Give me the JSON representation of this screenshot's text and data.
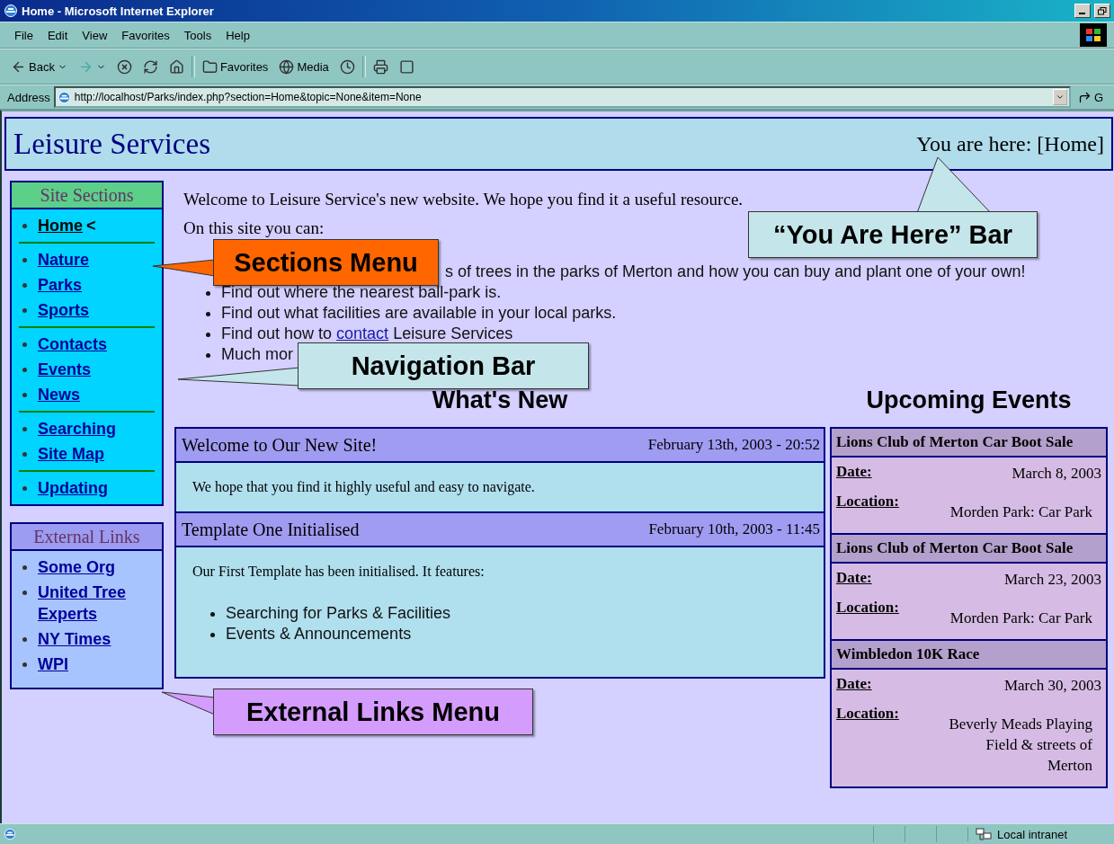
{
  "window": {
    "title": "Home - Microsoft Internet Explorer"
  },
  "menu": [
    "File",
    "Edit",
    "View",
    "Favorites",
    "Tools",
    "Help"
  ],
  "toolbar": [
    {
      "kind": "back",
      "label": "Back"
    },
    {
      "kind": "forward"
    },
    {
      "kind": "stop"
    },
    {
      "kind": "refresh"
    },
    {
      "kind": "home"
    },
    {
      "kind": "separator"
    },
    {
      "kind": "favorites",
      "label": "Favorites"
    },
    {
      "kind": "media",
      "label": "Media"
    },
    {
      "kind": "history"
    },
    {
      "kind": "separator"
    },
    {
      "kind": "print"
    },
    {
      "kind": "edit"
    }
  ],
  "address": {
    "label": "Address",
    "value": "http://localhost/Parks/index.php?section=Home&topic=None&item=None",
    "go": "G"
  },
  "header": {
    "title": "Leisure Services",
    "breadcrumb": "You are here: [Home]"
  },
  "site_sections": {
    "title": "Site Sections",
    "groups": [
      [
        {
          "label": "Home",
          "selected": true,
          "marker": "<"
        }
      ],
      [
        {
          "label": "Nature",
          "selected": false
        },
        {
          "label": "Parks",
          "selected": false
        },
        {
          "label": "Sports",
          "selected": false
        }
      ],
      [
        {
          "label": "Contacts",
          "selected": false
        },
        {
          "label": "Events",
          "selected": false
        },
        {
          "label": "News",
          "selected": false
        }
      ],
      [
        {
          "label": "Searching",
          "selected": false
        },
        {
          "label": "Site Map",
          "selected": false
        }
      ],
      [
        {
          "label": "Updating",
          "selected": false
        }
      ]
    ]
  },
  "external_links": {
    "title": "External Links",
    "items": [
      "Some Org",
      "United Tree Experts",
      "NY Times",
      "WPI"
    ]
  },
  "intro": {
    "welcome": "Welcome to Leisure Service's new website. We hope you find it a useful resource.",
    "lead": "On this site you can:",
    "bullets": [
      {
        "kind": "cut",
        "parts": [
          "s of trees in the parks of Merton and how you can buy and plant one of your own!"
        ]
      },
      {
        "kind": "plain",
        "parts": [
          "Find out where the nearest ball-park is."
        ]
      },
      {
        "kind": "plain",
        "parts": [
          "Find out what facilities are available in your local parks."
        ]
      },
      {
        "kind": "link",
        "parts": [
          "Find out how to ",
          "contact",
          " Leisure Services"
        ]
      },
      {
        "kind": "plain",
        "parts": [
          "Much mor"
        ]
      }
    ]
  },
  "whats_new": {
    "title": "What's New",
    "items": [
      {
        "title": "Welcome to Our New Site!",
        "date": "February 13th, 2003 - 20:52",
        "body": "We hope that you find it highly useful and easy to navigate."
      },
      {
        "title": "Template One Initialised",
        "date": "February 10th, 2003 - 11:45",
        "body": "Our First Template has been initialised. It features:",
        "bullets": [
          "Searching for Parks & Facilities",
          "Events & Announcements"
        ]
      }
    ]
  },
  "upcoming_events": {
    "title": "Upcoming Events",
    "items": [
      {
        "title": "Lions Club of Merton Car Boot Sale",
        "date_label": "Date:",
        "date": "March 8, 2003",
        "location_label": "Location:",
        "location": "Morden Park: Car Park"
      },
      {
        "title": "Lions Club of Merton Car Boot Sale",
        "date_label": "Date:",
        "date": "March 23, 2003",
        "location_label": "Location:",
        "location": "Morden Park: Car Park"
      },
      {
        "title": "Wimbledon 10K Race",
        "date_label": "Date:",
        "date": "March 30, 2003",
        "location_label": "Location:",
        "location": "Beverly Meads Playing Field & streets of Merton"
      }
    ]
  },
  "callouts": [
    {
      "text": "Sections Menu",
      "color": "#ff6600"
    },
    {
      "text": "“You Are Here” Bar",
      "color": "#c4e6ea"
    },
    {
      "text": "Navigation Bar",
      "color": "#c4e6ea"
    },
    {
      "text": "External Links Menu",
      "color": "#d49cfc"
    }
  ],
  "status_bar": {
    "zone": "Local intranet"
  }
}
